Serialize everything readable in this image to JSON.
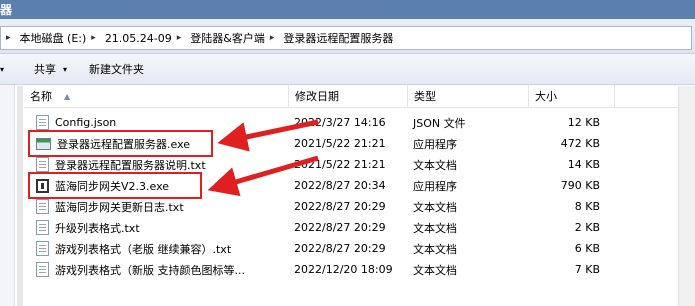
{
  "window": {
    "title_fragment": "器"
  },
  "address": {
    "crumbs": [
      {
        "label": ""
      },
      {
        "label": "本地磁盘 (E:)"
      },
      {
        "label": "21.05.24-09"
      },
      {
        "label": "登陆器&客户端"
      },
      {
        "label": "登录器远程配置服务器"
      }
    ]
  },
  "toolbar": {
    "share_label": "共享",
    "new_folder_label": "新建文件夹"
  },
  "columns": {
    "name": "名称",
    "date": "修改日期",
    "type": "类型",
    "size": "大小"
  },
  "files": [
    {
      "name": "Config.json",
      "date": "2022/3/27 14:16",
      "type": "JSON 文件",
      "size": "12 KB",
      "icon": "json-file-icon"
    },
    {
      "name": "登录器远程配置服务器.exe",
      "date": "2021/5/22 21:21",
      "type": "应用程序",
      "size": "472 KB",
      "icon": "app-window-icon"
    },
    {
      "name": "登录器远程配置服务器说明.txt",
      "date": "2021/5/22 21:21",
      "type": "文本文档",
      "size": "14 KB",
      "icon": "text-file-icon"
    },
    {
      "name": "蓝海同步网关V2.3.exe",
      "date": "2022/8/27 20:34",
      "type": "应用程序",
      "size": "790 KB",
      "icon": "gateway-app-icon"
    },
    {
      "name": "蓝海同步网关更新日志.txt",
      "date": "2022/8/27 20:29",
      "type": "文本文档",
      "size": "8 KB",
      "icon": "text-file-icon"
    },
    {
      "name": "升级列表格式.txt",
      "date": "2022/8/27 20:29",
      "type": "文本文档",
      "size": "2 KB",
      "icon": "text-file-icon"
    },
    {
      "name": "游戏列表格式（老版 继续兼容）.txt",
      "date": "2022/8/27 20:29",
      "type": "文本文档",
      "size": "6 KB",
      "icon": "text-file-icon"
    },
    {
      "name": "游戏列表格式（新版 支持颜色图标等...",
      "date": "2022/12/20 18:09",
      "type": "文本文档",
      "size": "7 KB",
      "icon": "text-file-icon"
    }
  ],
  "annotation_color": "#e02020"
}
